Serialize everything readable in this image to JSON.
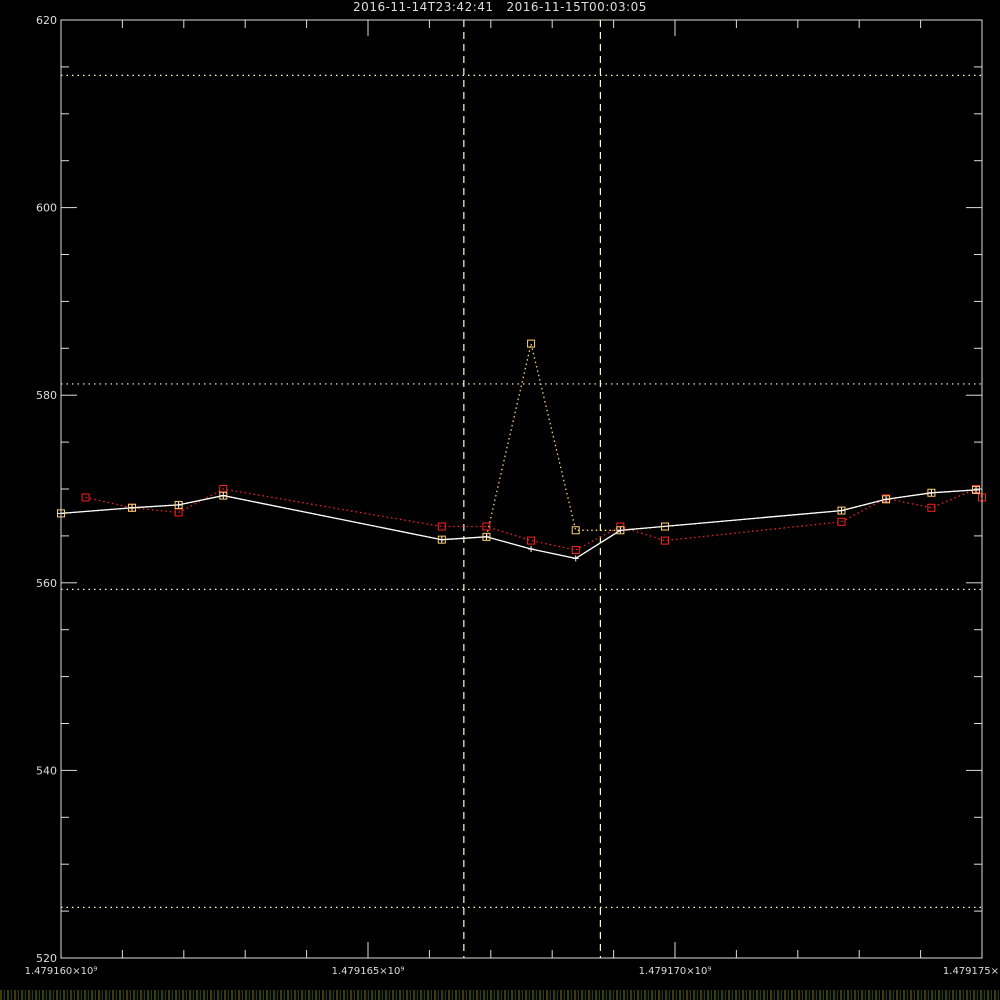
{
  "header": {
    "start_time": "2016-11-14T23:42:41",
    "end_time": "2016-11-15T00:03:05"
  },
  "chart_data": {
    "type": "line",
    "title": "",
    "xlabel": "",
    "ylabel": "",
    "xlim": [
      1479160000,
      1479175000
    ],
    "ylim": [
      520,
      620
    ],
    "x_ticks": [
      {
        "value": 1479160000,
        "label": "1.479160×10⁹"
      },
      {
        "value": 1479165000,
        "label": "1.479165×10⁹"
      },
      {
        "value": 1479170000,
        "label": "1.479170×10⁹"
      },
      {
        "value": 1479175000,
        "label": "1.479175×"
      }
    ],
    "y_ticks": [
      {
        "value": 520,
        "label": "520"
      },
      {
        "value": 540,
        "label": "540"
      },
      {
        "value": 560,
        "label": "560"
      },
      {
        "value": 580,
        "label": "580"
      },
      {
        "value": 600,
        "label": "600"
      },
      {
        "value": 620,
        "label": "620"
      }
    ],
    "y_minor_step": 5,
    "x_minor_step": 1000,
    "reference_lines": {
      "vertical_dashed_x": [
        1479166561,
        1479168785
      ],
      "horizontal_dotted_y": [
        614.1,
        581.2,
        559.3,
        525.4
      ],
      "color": "#ffffc0"
    },
    "series": [
      {
        "style": "solid",
        "marker": "plus",
        "color": "#ffffff",
        "x": [
          1479160000,
          1479161157,
          1479161916,
          1479162643,
          1479166202,
          1479166929,
          1479167656,
          1479168383,
          1479169110,
          1479172711,
          1479173438,
          1479174176,
          1479174903
        ],
        "y": [
          567.4,
          568.0,
          568.3,
          569.3,
          564.6,
          564.9,
          563.6,
          562.6,
          565.6,
          567.7,
          568.9,
          569.6,
          569.9
        ]
      },
      {
        "style": "dotted",
        "marker": "square",
        "color": "#ff2020",
        "x": [
          1479160400,
          1479161157,
          1479161916,
          1479162643,
          1479166202,
          1479166929,
          1479167656,
          1479168383,
          1479169110,
          1479169837,
          1479172711,
          1479173438,
          1479174176,
          1479174903,
          1479175000
        ],
        "y": [
          569.1,
          568.0,
          567.5,
          570.0,
          566.0,
          566.0,
          564.5,
          563.5,
          566.0,
          564.5,
          566.5,
          569.0,
          568.0,
          570.0,
          569.1
        ]
      },
      {
        "style": "dotted",
        "marker": "square",
        "color": "#ffd070",
        "x": [
          1479160000,
          1479161157,
          1479161916,
          1479162643,
          1479166202,
          1479166929,
          1479167656,
          1479168383,
          1479169110,
          1479169837,
          1479172711,
          1479173438,
          1479174176,
          1479174903
        ],
        "y": [
          567.4,
          568.0,
          568.3,
          569.3,
          564.6,
          564.9,
          585.5,
          565.6,
          565.6,
          566.0,
          567.7,
          568.9,
          569.6,
          569.9
        ]
      }
    ]
  }
}
